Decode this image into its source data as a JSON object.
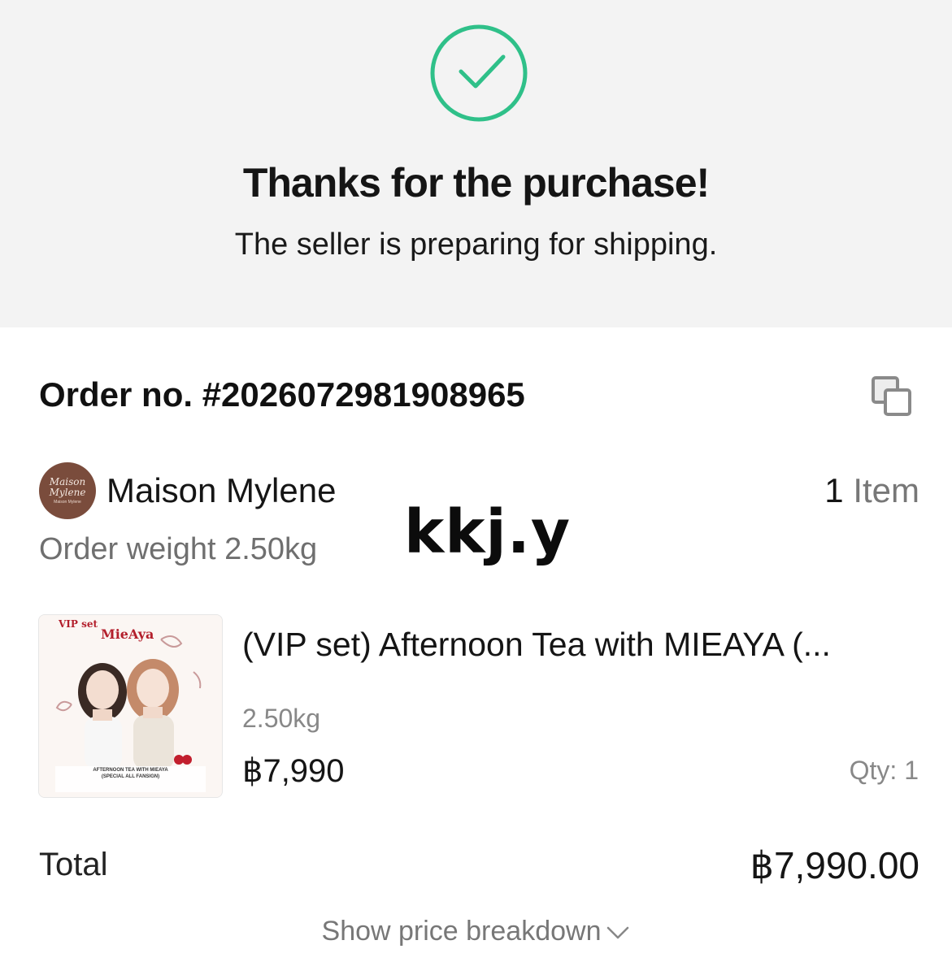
{
  "header": {
    "title": "Thanks for the purchase!",
    "subtitle": "The seller is preparing for shipping.",
    "success_icon": "check-circle-icon",
    "accent_color": "#2fc089"
  },
  "order": {
    "number_label": "Order no. #2026072981908965",
    "copy_icon": "copy-icon"
  },
  "store": {
    "avatar_text": "Maison Mylene",
    "avatar_subtext": "Maison Mylene",
    "name": "Maison Mylene",
    "item_count_number": "1",
    "item_count_label": "Item",
    "order_weight": "Order weight 2.50kg"
  },
  "overlay_text": "kkj.y",
  "product": {
    "image_caption_top": "VIP set",
    "image_brand": "MieAya",
    "image_caption_bottom": "AFTERNOON TEA WITH MIEAYA",
    "image_caption_sub": "(SPECIAL ALL FANSIGN)",
    "title": "(VIP set) Afternoon Tea with MIEAYA (...",
    "weight": "2.50kg",
    "price": "฿7,990",
    "qty": "Qty: 1"
  },
  "summary": {
    "total_label": "Total",
    "total_value": "฿7,990.00",
    "breakdown_label": "Show price breakdown"
  }
}
